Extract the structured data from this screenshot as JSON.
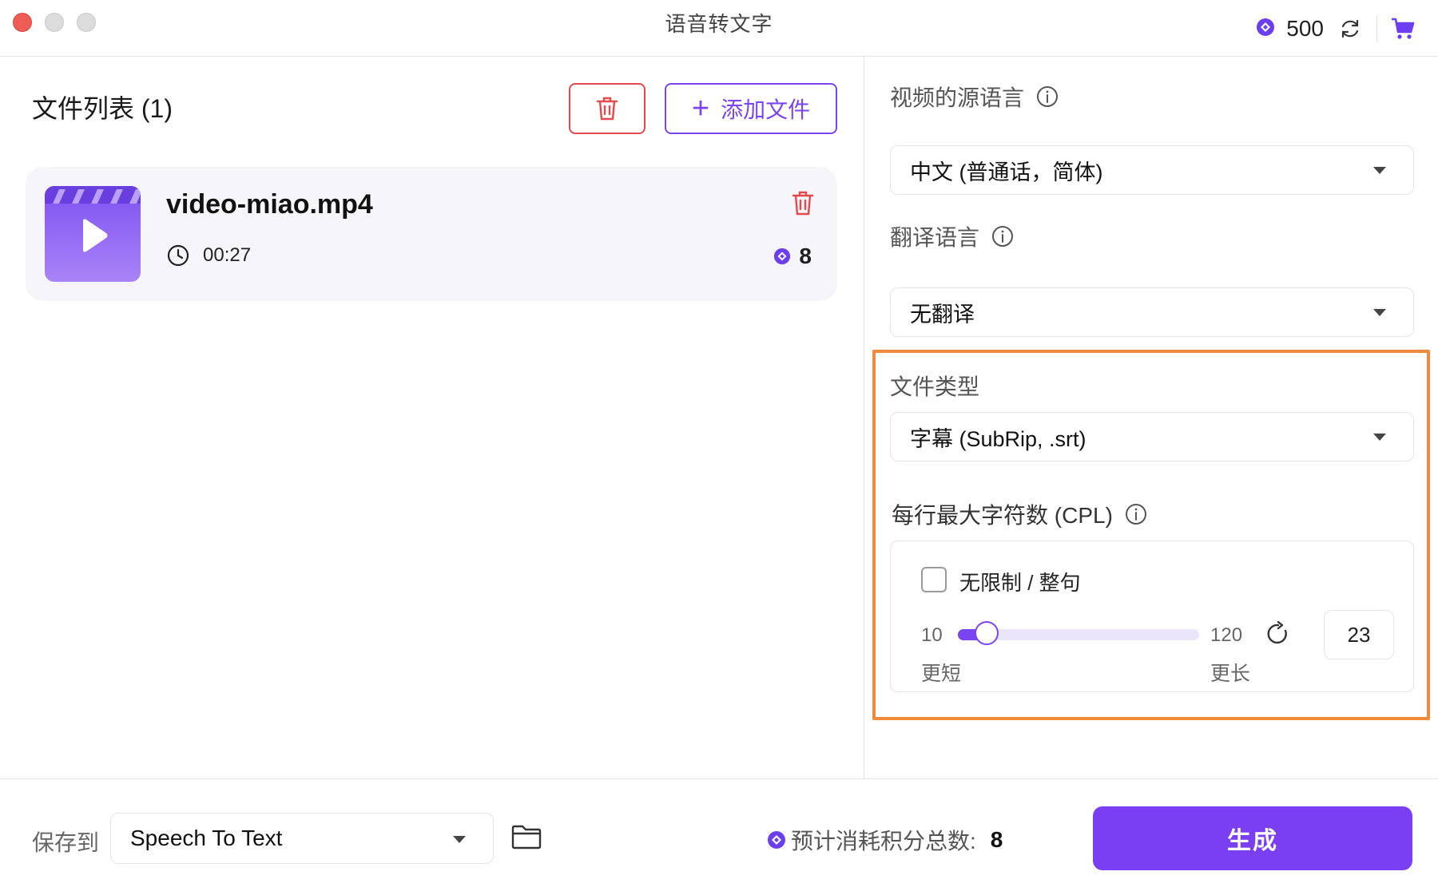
{
  "window": {
    "title": "语音转文字"
  },
  "header": {
    "credits": "500",
    "icons": [
      "credit-gem-icon",
      "refresh-icon",
      "cart-icon"
    ]
  },
  "file_list": {
    "title": "文件列表 (1)",
    "add_button": "添加文件",
    "files": [
      {
        "name": "video-miao.mp4",
        "duration": "00:27",
        "cost": "8"
      }
    ]
  },
  "settings": {
    "source_language": {
      "label": "视频的源语言",
      "value": "中文 (普通话，简体)"
    },
    "translation_language": {
      "label": "翻译语言",
      "value": "无翻译"
    },
    "file_type": {
      "label": "文件类型",
      "value": "字幕 (SubRip, .srt)"
    },
    "cpl": {
      "label": "每行最大字符数 (CPL)",
      "unlimited_label": "无限制 / 整句",
      "unlimited_checked": false,
      "min": "10",
      "max": "120",
      "min_label": "更短",
      "max_label": "更长",
      "value": "23",
      "slider_value": 23
    }
  },
  "footer": {
    "save_label": "保存到",
    "save_location": "Speech To Text",
    "estimate_label": "预计消耗积分总数:",
    "estimate_value": "8",
    "generate_label": "生成"
  },
  "colors": {
    "accent": "#7a45f0",
    "danger": "#e5484d",
    "highlight": "#f08a3c"
  }
}
